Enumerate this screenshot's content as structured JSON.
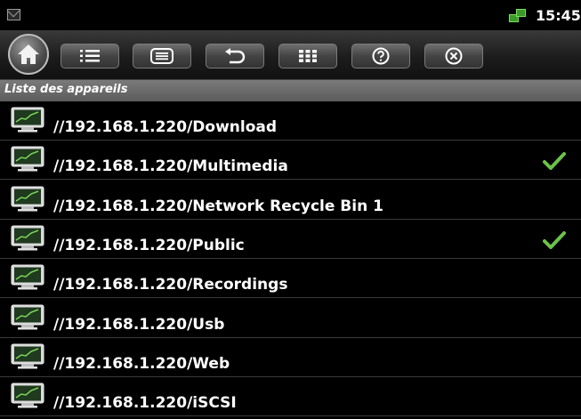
{
  "statusbar": {
    "time": "15:45",
    "left_icon": "mail-icon",
    "right_icon": "network-icon"
  },
  "toolbar": {
    "buttons": [
      {
        "name": "home-button",
        "icon": "home-icon"
      },
      {
        "name": "list-button",
        "icon": "list-icon"
      },
      {
        "name": "details-button",
        "icon": "details-icon"
      },
      {
        "name": "back-button",
        "icon": "undo-icon"
      },
      {
        "name": "grid-button",
        "icon": "grid-icon"
      },
      {
        "name": "help-button",
        "icon": "help-icon"
      },
      {
        "name": "close-button",
        "icon": "close-icon"
      }
    ]
  },
  "list": {
    "header": "Liste des appareils",
    "items": [
      {
        "label": "//192.168.1.220/Download",
        "checked": false
      },
      {
        "label": "//192.168.1.220/Multimedia",
        "checked": true
      },
      {
        "label": "//192.168.1.220/Network Recycle Bin 1",
        "checked": false
      },
      {
        "label": "//192.168.1.220/Public",
        "checked": true
      },
      {
        "label": "//192.168.1.220/Recordings",
        "checked": false
      },
      {
        "label": "//192.168.1.220/Usb",
        "checked": false
      },
      {
        "label": "//192.168.1.220/Web",
        "checked": false
      },
      {
        "label": "//192.168.1.220/iSCSI",
        "checked": false
      }
    ]
  },
  "colors": {
    "check": "#6cc24a",
    "header_bg": "#6a6a6a",
    "background": "#000000"
  }
}
